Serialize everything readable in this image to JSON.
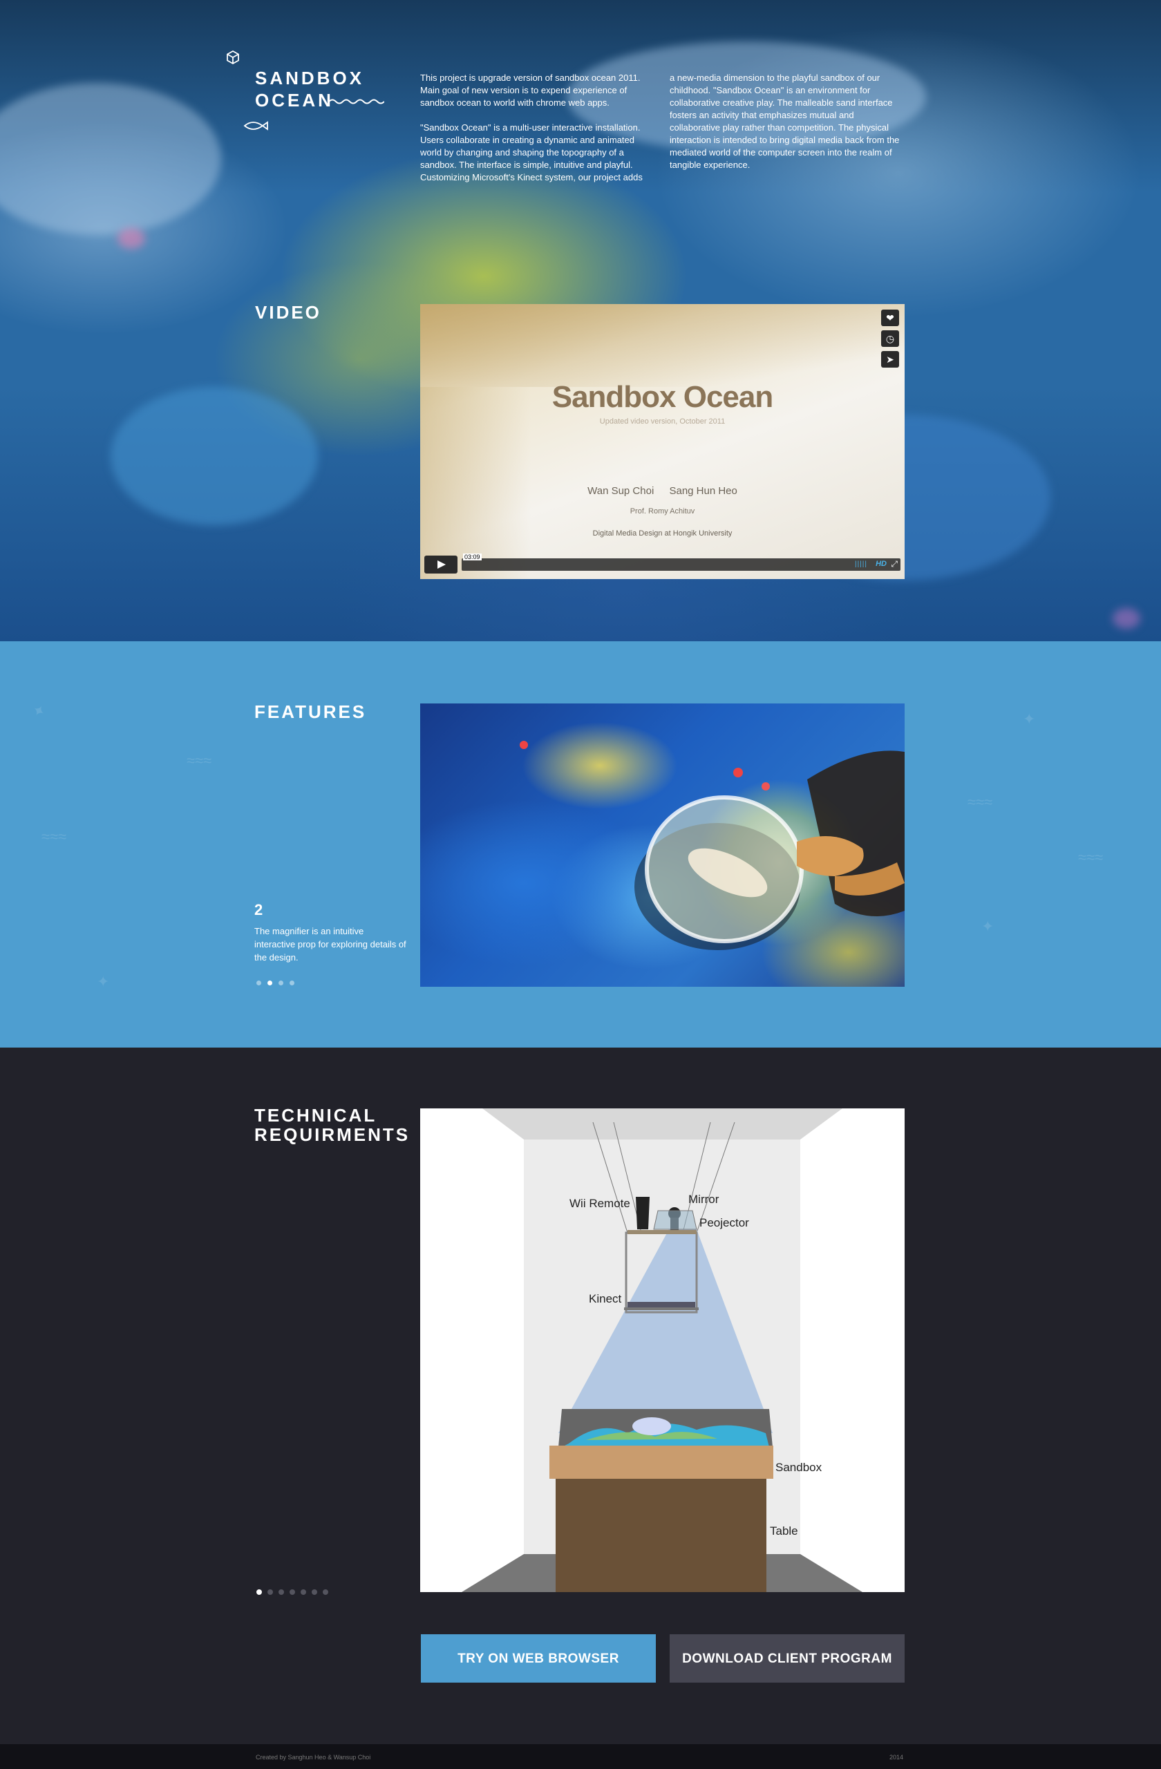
{
  "colors": {
    "hero_blue": "#2a6aa4",
    "features_bg": "#4e9ed0",
    "tech_bg": "#22222a",
    "primary_button": "#4e9ed0",
    "secondary_button": "#464652",
    "footer_bg": "#111116"
  },
  "header": {
    "logo_icon": "cube-icon",
    "title_line1": "SANDBOX",
    "title_line2": "OCEAN",
    "wave_icon": "wave-icon",
    "fish_icon": "fish-icon"
  },
  "intro": {
    "col1_p1": "This project is upgrade version of sandbox ocean 2011. Main goal of new version is to expend experience of sandbox ocean to world with chrome web apps.",
    "col1_p2": "\"Sandbox Ocean\" is a multi-user interactive installation. Users collaborate in creating a dynamic and animated world by changing and shaping the topography of a sandbox. The interface is simple, intuitive and playful. Customizing Microsoft's Kinect system, our project adds",
    "col2_p1": "a new-media dimension to the playful sandbox of our childhood. \"Sandbox Ocean\" is an environment for collaborative creative play. The malleable sand interface fosters an activity that emphasizes mutual and collaborative play rather than competition. The physical interaction is intended to bring digital media back from the mediated world of the computer screen into the realm of tangible experience."
  },
  "video": {
    "section_title": "VIDEO",
    "title": "Sandbox Ocean",
    "subtitle": "Updated video version, October 2011",
    "author1": "Wan Sup Choi",
    "author2": "Sang Hun Heo",
    "professor": "Prof. Romy Achituv",
    "school": "Digital Media Design at Hongik University",
    "time": "03:09",
    "hd_label": "HD",
    "icons": [
      "heart-icon",
      "clock-icon",
      "send-icon"
    ]
  },
  "features": {
    "section_title": "FEATURES",
    "number": "2",
    "text": "The magnifier is an intuitive interactive prop for exploring details of the design.",
    "slides_total": 4,
    "active_slide": 2
  },
  "tech": {
    "title_line1": "TECHNICAL",
    "title_line2": "REQUIRMENTS",
    "labels": {
      "wii": "Wii Remote",
      "mirror": "Mirror",
      "projector": "Peojector",
      "kinect": "Kinect",
      "sandbox": "Sandbox",
      "table": "Table"
    },
    "slides_total": 7,
    "active_slide": 1
  },
  "buttons": {
    "try": "TRY ON WEB BROWSER",
    "download": "DOWNLOAD CLIENT PROGRAM"
  },
  "footer": {
    "credit": "Created by Sanghun Heo & Wansup Choi",
    "year": "2014"
  }
}
